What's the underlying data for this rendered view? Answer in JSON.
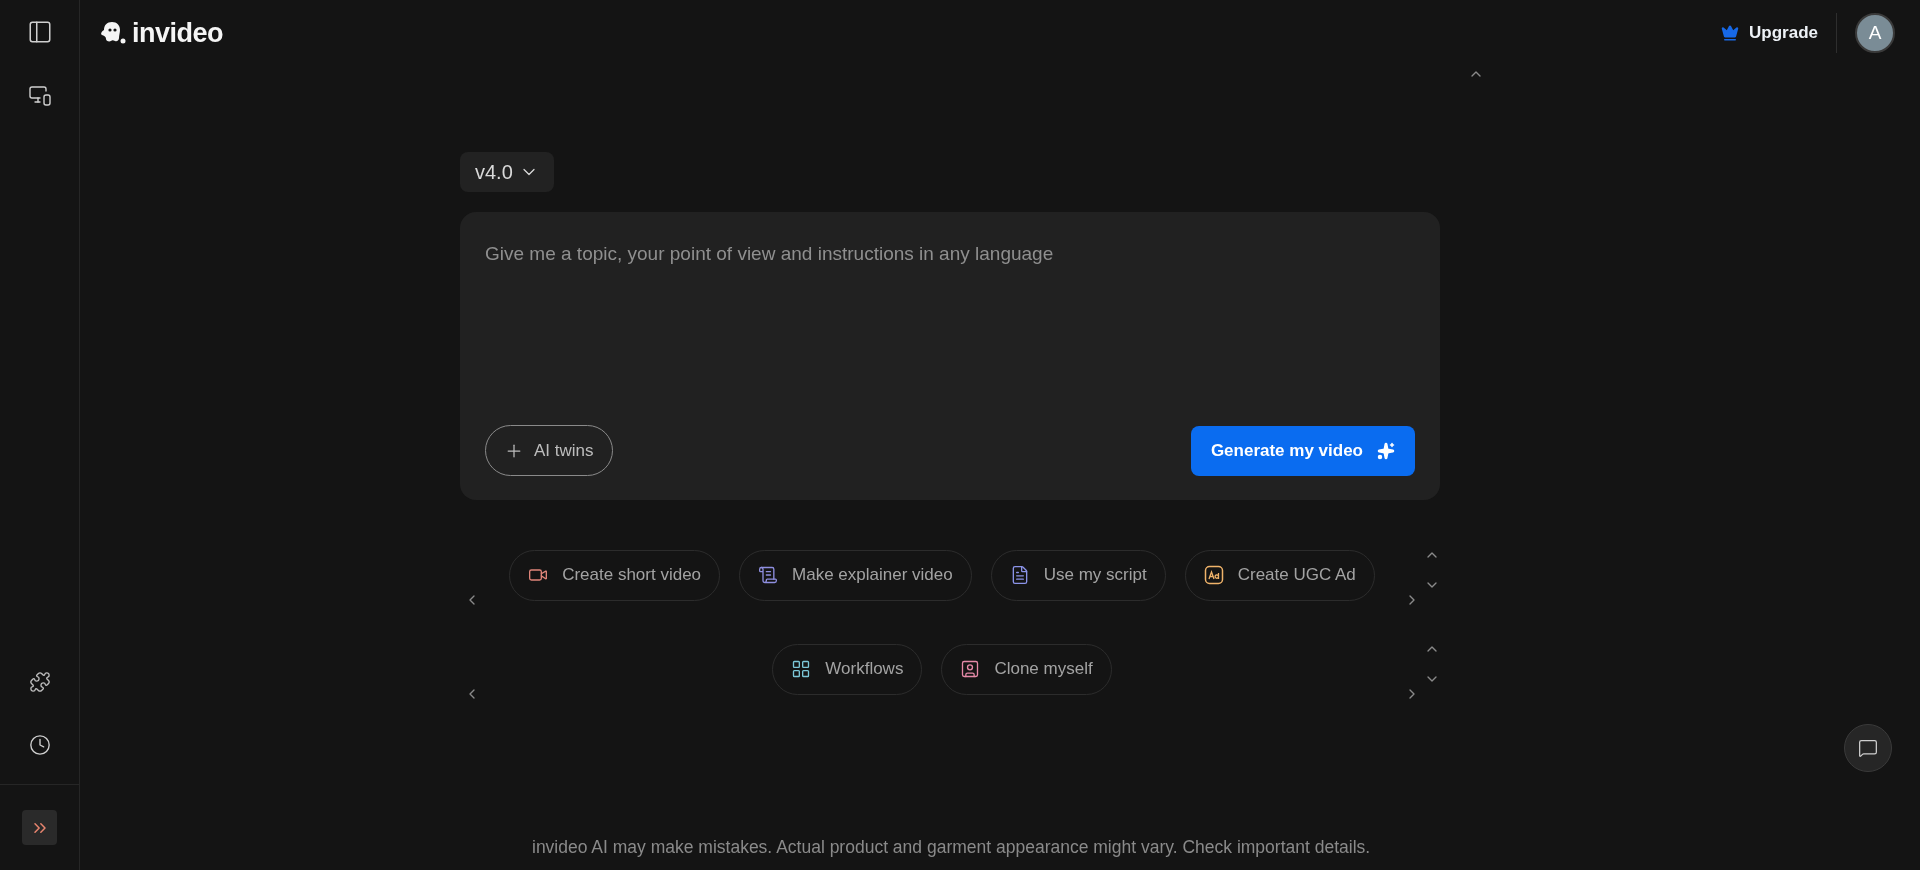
{
  "header": {
    "logo": "invideo",
    "upgrade": "Upgrade",
    "avatar": "A"
  },
  "version": {
    "label": "v4.0"
  },
  "prompt": {
    "placeholder": "Give me a topic, your point of view and instructions in any language",
    "add_button": "AI twins",
    "generate_button": "Generate my video"
  },
  "chip_rows": [
    {
      "chips": [
        {
          "label": "Create short video"
        },
        {
          "label": "Make explainer video"
        },
        {
          "label": "Use my script"
        },
        {
          "label": "Create UGC Ad"
        }
      ]
    },
    {
      "chips": [
        {
          "label": "Workflows"
        },
        {
          "label": "Clone myself"
        }
      ]
    }
  ],
  "footer": "invideo AI may make mistakes. Actual product and garment appearance might vary. Check important details."
}
